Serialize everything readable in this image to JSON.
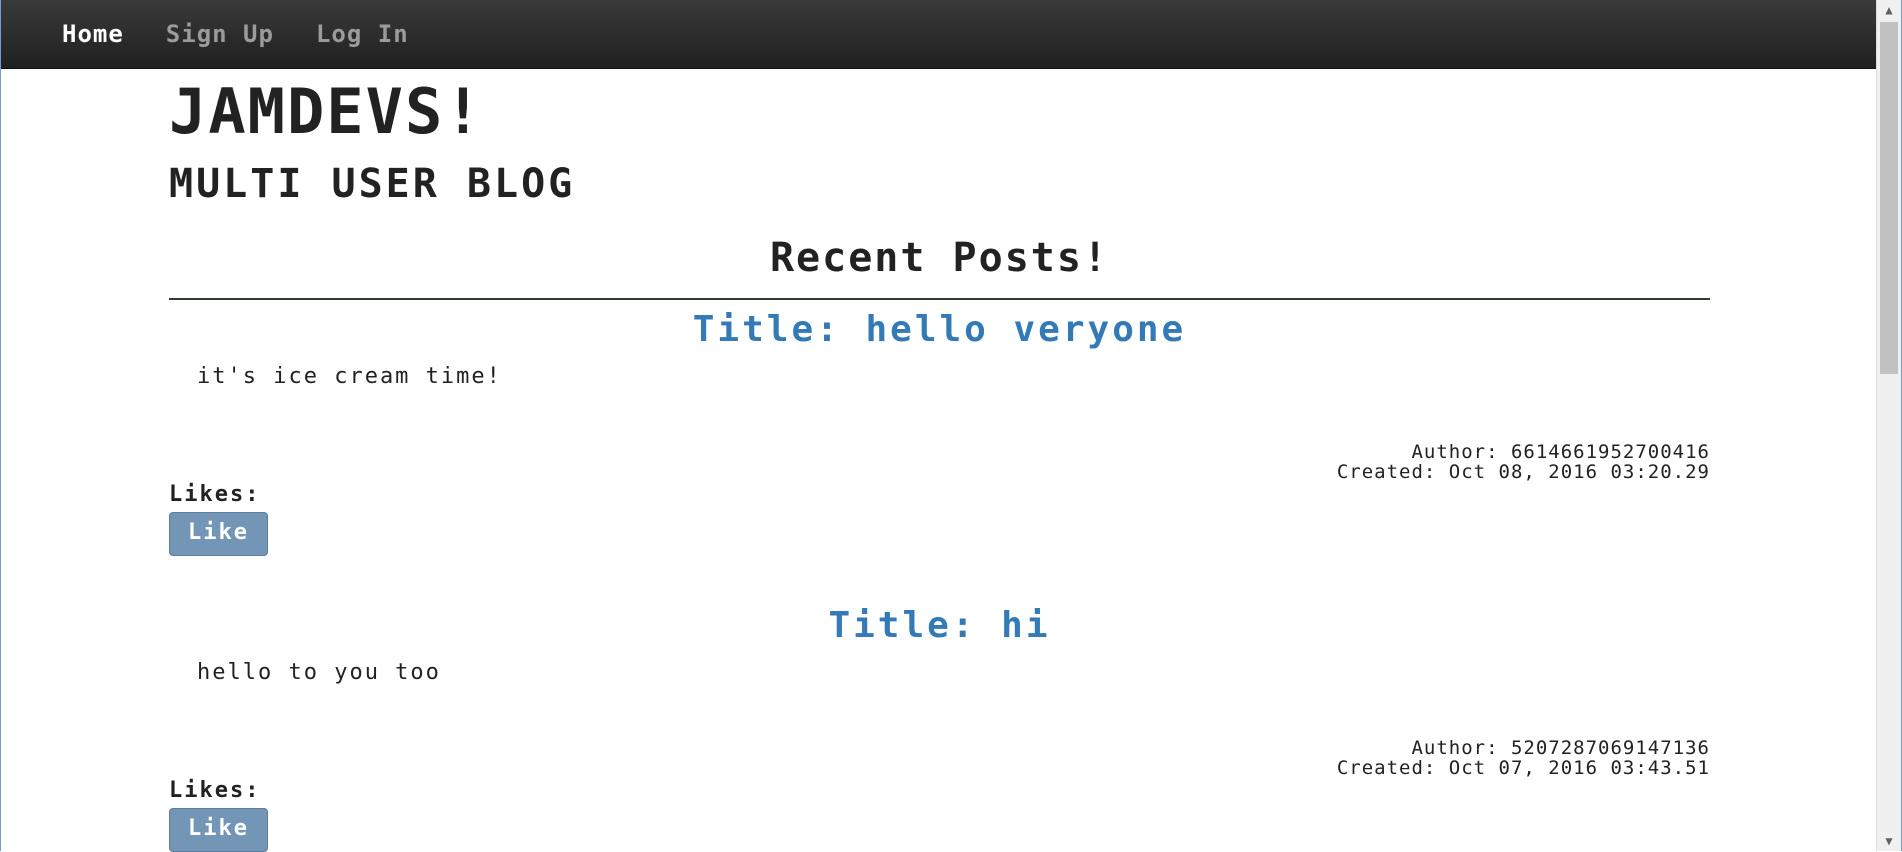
{
  "nav": {
    "items": [
      {
        "label": "Home",
        "active": true
      },
      {
        "label": "Sign Up",
        "active": false
      },
      {
        "label": "Log In",
        "active": false
      }
    ]
  },
  "header": {
    "title": "JAMDEVS!",
    "subtitle": "MULTI USER BLOG"
  },
  "main": {
    "section_title": "Recent Posts!",
    "posts": [
      {
        "title": "Title: hello veryone",
        "body": "it's ice cream time!",
        "author": "Author: 6614661952700416",
        "created": "Created: Oct 08, 2016 03:20.29",
        "likes_label": "Likes:",
        "like_button": "Like"
      },
      {
        "title": "Title: hi",
        "body": "hello to you too",
        "author": "Author: 5207287069147136",
        "created": "Created: Oct 07, 2016 03:43.51",
        "likes_label": "Likes:",
        "like_button": "Like"
      }
    ]
  },
  "colors": {
    "navbar": "#2b2b2b",
    "post_title": "#337ab7",
    "like_button": "#7395b6"
  }
}
